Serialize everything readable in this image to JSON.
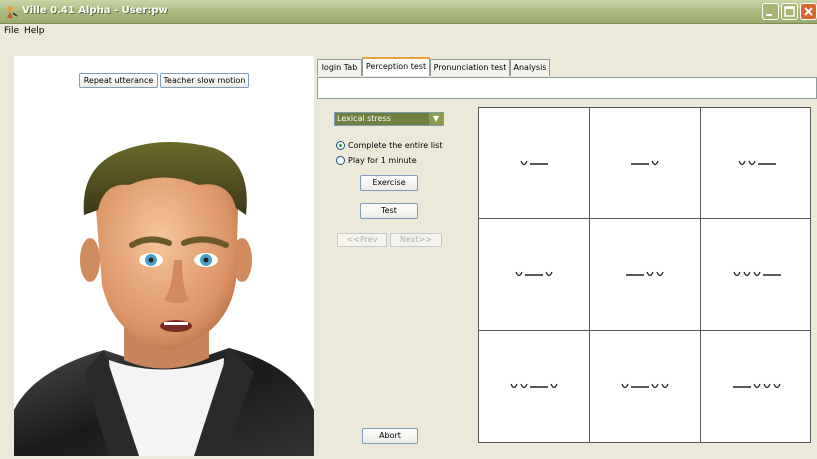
{
  "window": {
    "title": "Ville 0.41 Alpha - User:pw"
  },
  "menu": [
    "File",
    "Help"
  ],
  "left_toolbar": {
    "repeat_label": "Repeat utterance",
    "slow_label": "Teacher slow motion"
  },
  "tabs": [
    {
      "label": "login Tab",
      "active": false
    },
    {
      "label": "Perception test",
      "active": true
    },
    {
      "label": "Pronunciation test",
      "active": false
    },
    {
      "label": "Analysis",
      "active": false
    }
  ],
  "controls": {
    "mode_select": {
      "value": "Lexical stress"
    },
    "radios": [
      {
        "label": "Complete the entire list",
        "checked": true
      },
      {
        "label": "Play for 1 minute",
        "checked": false
      }
    ],
    "exercise_label": "Exercise",
    "test_label": "Test",
    "prev_label": "<<Prev",
    "next_label": "Next>>",
    "abort_label": "Abort"
  },
  "stress_patterns": [
    [
      "u",
      "-"
    ],
    [
      "-",
      "u"
    ],
    [
      "u",
      "u",
      "-"
    ],
    [
      "u",
      "-",
      "u"
    ],
    [
      "-",
      "u",
      "u"
    ],
    [
      "u",
      "u",
      "u",
      "-"
    ],
    [
      "u",
      "u",
      "-",
      "u"
    ],
    [
      "u",
      "-",
      "u",
      "u"
    ],
    [
      "-",
      "u",
      "u",
      "u"
    ]
  ],
  "colors": {
    "titlebar": "#9aab6c",
    "active_tab_accent": "#e9a13b",
    "select_bg": "#6f7f3f"
  }
}
